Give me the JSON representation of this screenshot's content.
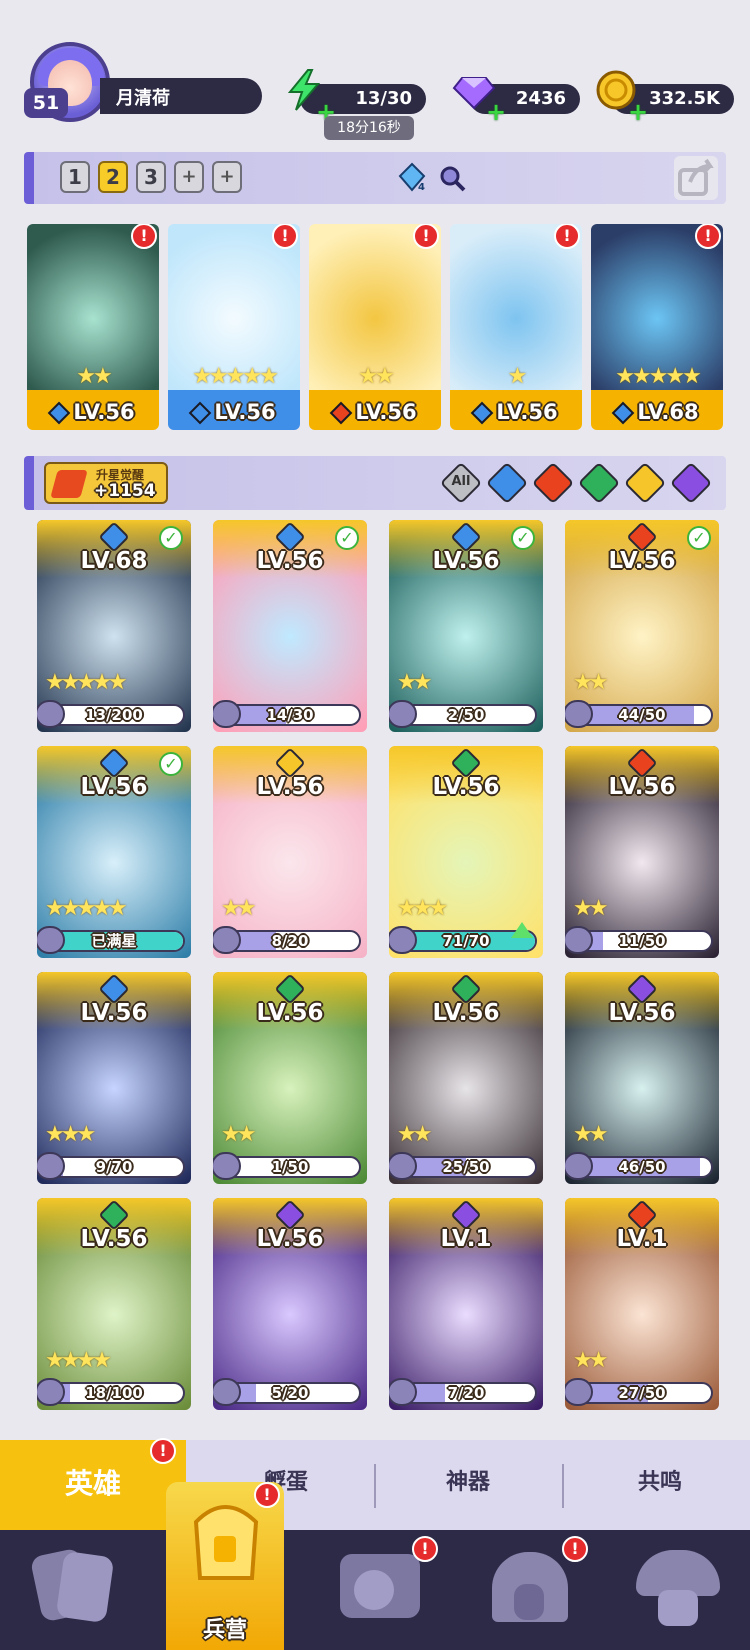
{
  "player": {
    "level": "51",
    "name": "月清荷"
  },
  "resources": {
    "energy": {
      "value": "13/30",
      "timer": "18分16秒",
      "icon": "lightning-icon"
    },
    "gems": {
      "value": "2436",
      "icon": "purple-gem-icon"
    },
    "coins": {
      "value": "332.5K",
      "icon": "gold-coin-icon"
    }
  },
  "team": {
    "tabs": [
      "1",
      "2",
      "3",
      "+",
      "+"
    ],
    "active_tab": "2",
    "gem_count": "4",
    "members": [
      {
        "level": "LV.56",
        "stars": "★★",
        "element": "water",
        "foot": "gold"
      },
      {
        "level": "LV.56",
        "stars": "★★★★★",
        "element": "water",
        "foot": "blue"
      },
      {
        "level": "LV.56",
        "stars": "★★",
        "element": "fire",
        "foot": "gold"
      },
      {
        "level": "LV.56",
        "stars": "★",
        "element": "water",
        "foot": "gold"
      },
      {
        "level": "LV.68",
        "stars": "★★★★★",
        "element": "water",
        "foot": "gold"
      }
    ]
  },
  "awaken": {
    "title": "升星觉醒",
    "value": "+1154"
  },
  "filters": [
    "All",
    "water",
    "fire",
    "wind",
    "light",
    "dark"
  ],
  "heroes": [
    {
      "level": "LV.68",
      "element": "water",
      "checked": true,
      "stars": "★★★★★",
      "progress": "13/200",
      "fill": 0.07,
      "full": false
    },
    {
      "level": "LV.56",
      "element": "water",
      "checked": true,
      "stars": "",
      "progress": "14/30",
      "fill": 0.47,
      "full": false
    },
    {
      "level": "LV.56",
      "element": "water",
      "checked": true,
      "stars": "★★",
      "progress": "2/50",
      "fill": 0.04,
      "full": false
    },
    {
      "level": "LV.56",
      "element": "fire",
      "checked": true,
      "stars": "★★",
      "progress": "44/50",
      "fill": 0.88,
      "full": false
    },
    {
      "level": "LV.56",
      "element": "water",
      "checked": true,
      "stars": "★★★★★",
      "progress": "已满星",
      "fill": 1.0,
      "full": true
    },
    {
      "level": "LV.56",
      "element": "light",
      "checked": false,
      "stars": "★★",
      "progress": "8/20",
      "fill": 0.4,
      "full": false
    },
    {
      "level": "LV.56",
      "element": "wind",
      "checked": false,
      "stars": "★★★",
      "progress": "71/70",
      "fill": 1.0,
      "full": true,
      "upgrade": true
    },
    {
      "level": "LV.56",
      "element": "fire",
      "checked": false,
      "stars": "★★",
      "progress": "11/50",
      "fill": 0.22,
      "full": false
    },
    {
      "level": "LV.56",
      "element": "water",
      "checked": false,
      "stars": "★★★",
      "progress": "9/70",
      "fill": 0.13,
      "full": false
    },
    {
      "level": "LV.56",
      "element": "wind",
      "checked": false,
      "stars": "★★",
      "progress": "1/50",
      "fill": 0.02,
      "full": false
    },
    {
      "level": "LV.56",
      "element": "wind",
      "checked": false,
      "stars": "★★",
      "progress": "25/50",
      "fill": 0.5,
      "full": false
    },
    {
      "level": "LV.56",
      "element": "dark",
      "checked": false,
      "stars": "★★",
      "progress": "46/50",
      "fill": 0.92,
      "full": false
    },
    {
      "level": "LV.56",
      "element": "wind",
      "checked": false,
      "stars": "★★★★",
      "progress": "18/100",
      "fill": 0.18,
      "full": false
    },
    {
      "level": "LV.56",
      "element": "dark",
      "checked": false,
      "stars": "",
      "progress": "5/20",
      "fill": 0.25,
      "full": false
    },
    {
      "level": "LV.1",
      "element": "dark",
      "checked": false,
      "stars": "",
      "progress": "7/20",
      "fill": 0.35,
      "full": false
    },
    {
      "level": "LV.1",
      "element": "fire",
      "checked": false,
      "stars": "★★",
      "progress": "27/50",
      "fill": 0.54,
      "full": false
    }
  ],
  "tabs": {
    "hero": "英雄",
    "hatch": "孵蛋",
    "artifact": "神器",
    "resonance": "共鸣"
  },
  "nav": {
    "barracks": "兵营"
  },
  "colors": {
    "water": "#3f8ee8",
    "fire": "#e8421f",
    "wind": "#2fb05a",
    "light": "#f5c52a",
    "dark": "#8a4fe0",
    "all": "#bdbdc4"
  }
}
